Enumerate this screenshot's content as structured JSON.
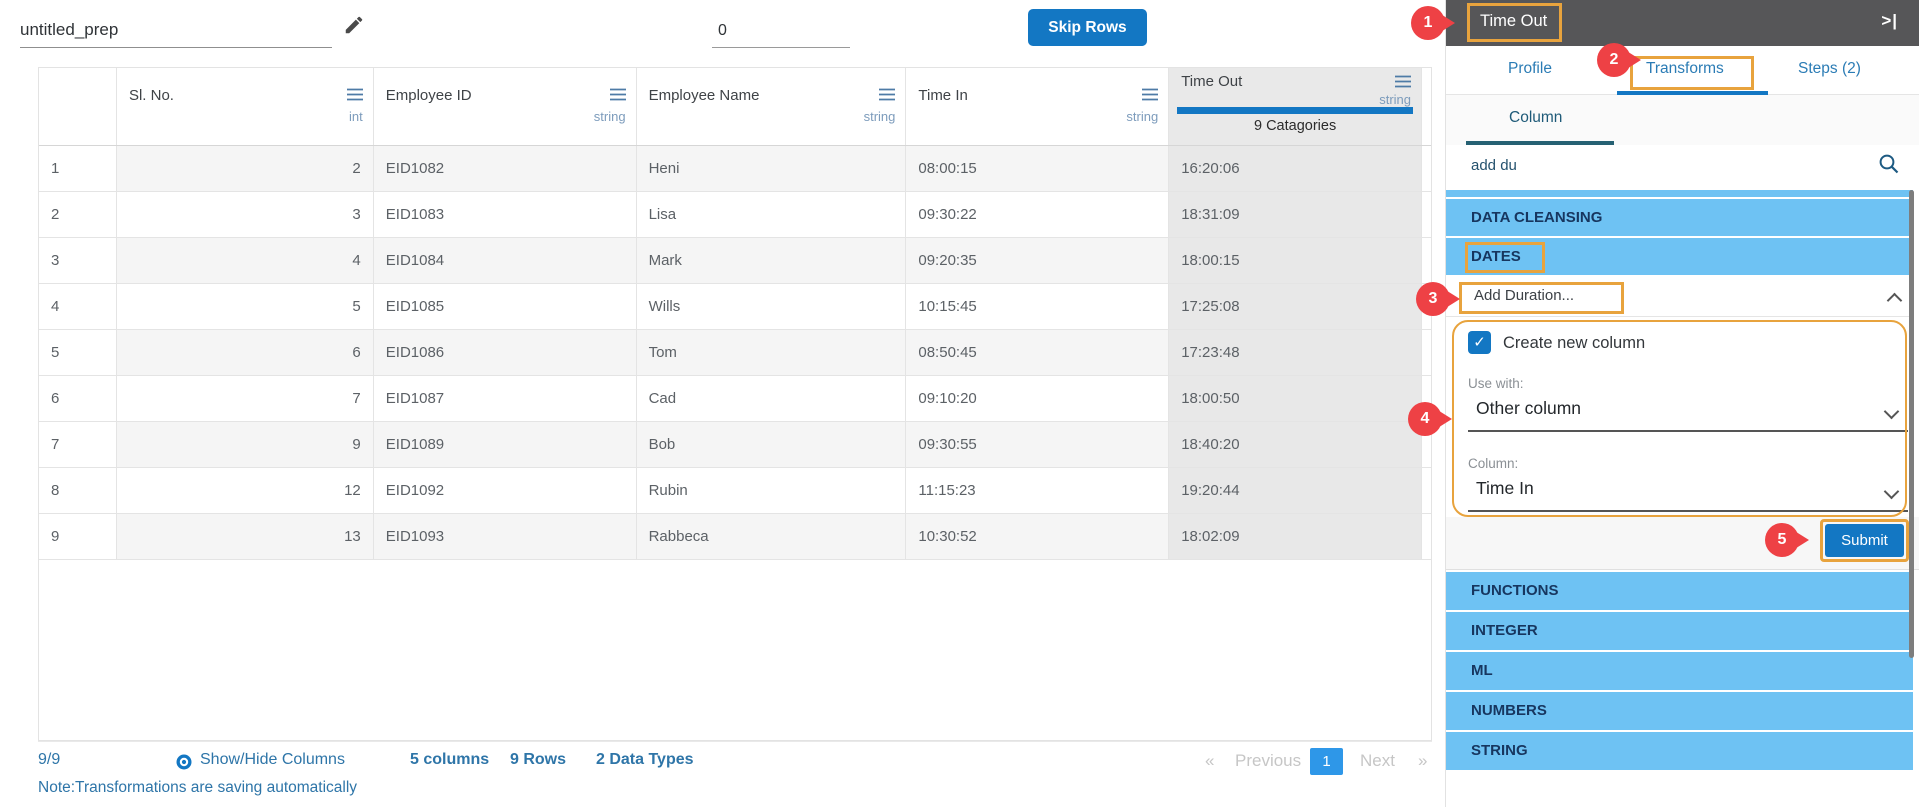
{
  "top_bar": {
    "prep_name": "untitled_prep",
    "skip_rows_value": "0",
    "skip_rows_button": "Skip Rows"
  },
  "table": {
    "columns": [
      {
        "label": "Sl. No.",
        "type": "int"
      },
      {
        "label": "Employee ID",
        "type": "string"
      },
      {
        "label": "Employee Name",
        "type": "string"
      },
      {
        "label": "Time In",
        "type": "string"
      },
      {
        "label": "Time Out",
        "type": "string",
        "categories": "9 Catagories",
        "selected": true
      }
    ],
    "rows": [
      {
        "num": "1",
        "slno": "2",
        "eid": "EID1082",
        "name": "Heni",
        "tin": "08:00:15",
        "tout": "16:20:06"
      },
      {
        "num": "2",
        "slno": "3",
        "eid": "EID1083",
        "name": "Lisa",
        "tin": "09:30:22",
        "tout": "18:31:09"
      },
      {
        "num": "3",
        "slno": "4",
        "eid": "EID1084",
        "name": "Mark",
        "tin": "09:20:35",
        "tout": "18:00:15"
      },
      {
        "num": "4",
        "slno": "5",
        "eid": "EID1085",
        "name": "Wills",
        "tin": "10:15:45",
        "tout": "17:25:08"
      },
      {
        "num": "5",
        "slno": "6",
        "eid": "EID1086",
        "name": "Tom",
        "tin": "08:50:45",
        "tout": "17:23:48"
      },
      {
        "num": "6",
        "slno": "7",
        "eid": "EID1087",
        "name": "Cad",
        "tin": "09:10:20",
        "tout": "18:00:50"
      },
      {
        "num": "7",
        "slno": "9",
        "eid": "EID1089",
        "name": "Bob",
        "tin": "09:30:55",
        "tout": "18:40:20"
      },
      {
        "num": "8",
        "slno": "12",
        "eid": "EID1092",
        "name": "Rubin",
        "tin": "11:15:23",
        "tout": "19:20:44"
      },
      {
        "num": "9",
        "slno": "13",
        "eid": "EID1093",
        "name": "Rabbeca",
        "tin": "10:30:52",
        "tout": "18:02:09"
      }
    ]
  },
  "footer": {
    "count": "9/9",
    "show_hide": "Show/Hide Columns",
    "summary_columns": "5 columns",
    "summary_rows": "9 Rows",
    "summary_types": "2 Data Types",
    "pagination": {
      "first": "«",
      "prev": "Previous",
      "page": "1",
      "next": "Next",
      "last": "»"
    },
    "note": "Note:Transformations are saving automatically"
  },
  "sidebar": {
    "title": "Time Out",
    "collapse_icon": ">|",
    "tabs": [
      {
        "label": "Profile"
      },
      {
        "label": "Transforms",
        "active": true
      },
      {
        "label": "Steps (2)"
      }
    ],
    "subtab": "Column",
    "search_value": "add du",
    "list_top": [
      "DATA CLEANSING",
      "DATES"
    ],
    "expanded_item": "Add Duration...",
    "form": {
      "checkbox_label": "Create new column",
      "checkbox_checked": true,
      "check_glyph": "✓",
      "use_with_label": "Use with:",
      "use_with_value": "Other column",
      "column_label": "Column:",
      "column_value": "Time In",
      "submit": "Submit"
    },
    "list_bottom": [
      "FUNCTIONS",
      "INTEGER",
      "ML",
      "NUMBERS",
      "STRING"
    ]
  },
  "annotations": [
    "1",
    "2",
    "3",
    "4",
    "5"
  ],
  "icons": {
    "pencil": "pencil-icon",
    "search": "search-icon",
    "eye": "eye-icon",
    "column_menu": "menu-icon",
    "collapse": "collapse-right-icon",
    "chevron_up": "chevron-up-icon",
    "chevron_down": "chevron-down-icon"
  },
  "colors": {
    "accent_blue": "#1377c3",
    "list_blue": "#6ec2f3",
    "pin_red": "#ee4145",
    "annotation_orange": "#e8a33d",
    "tab_blue": "#2b7cb5",
    "footer_blue": "#2e75a8",
    "header_gray": "#565658",
    "selected_column_gray": "#e8e8e8"
  }
}
